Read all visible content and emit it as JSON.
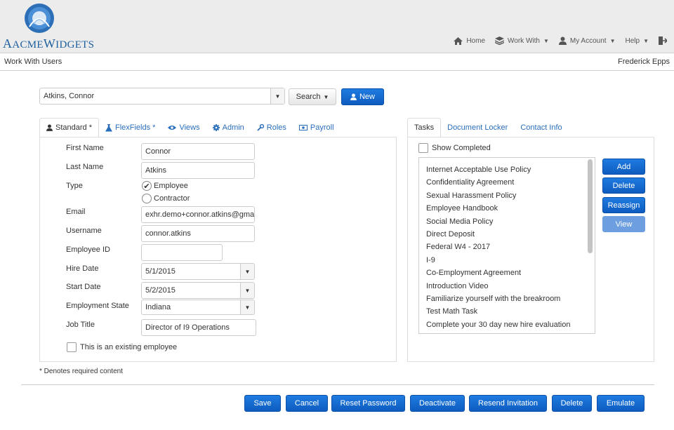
{
  "brand": {
    "name_part1": "Acme",
    "name_part2": "Widgets"
  },
  "topnav": {
    "home": "Home",
    "work_with": "Work With",
    "my_account": "My Account",
    "help": "Help"
  },
  "breadcrumb": "Work With Users",
  "current_user": "Frederick Epps",
  "user_select": {
    "value": "Atkins, Connor"
  },
  "search_button": "Search",
  "new_button": "New",
  "left_tabs": [
    {
      "label": "Standard *",
      "icon": "user-icon"
    },
    {
      "label": "FlexFields *",
      "icon": "flask-icon"
    },
    {
      "label": "Views",
      "icon": "eye-icon"
    },
    {
      "label": "Admin",
      "icon": "gear-icon"
    },
    {
      "label": "Roles",
      "icon": "wrench-icon"
    },
    {
      "label": "Payroll",
      "icon": "money-icon"
    }
  ],
  "form": {
    "first_name": {
      "label": "First Name",
      "value": "Connor"
    },
    "last_name": {
      "label": "Last Name",
      "value": "Atkins"
    },
    "type": {
      "label": "Type",
      "options": [
        "Employee",
        "Contractor"
      ],
      "selected": "Employee"
    },
    "email": {
      "label": "Email",
      "value": "exhr.demo+connor.atkins@gmai"
    },
    "username": {
      "label": "Username",
      "value": "connor.atkins"
    },
    "employee_id": {
      "label": "Employee ID",
      "value": ""
    },
    "hire_date": {
      "label": "Hire Date",
      "value": "5/1/2015"
    },
    "start_date": {
      "label": "Start Date",
      "value": "5/2/2015"
    },
    "employment_state": {
      "label": "Employment State",
      "value": "Indiana"
    },
    "job_title": {
      "label": "Job Title",
      "value": "Director of I9 Operations"
    },
    "existing_employee": {
      "label": "This is an existing employee",
      "checked": false
    }
  },
  "required_note": "* Denotes required content",
  "right_tabs": [
    "Tasks",
    "Document Locker",
    "Contact Info"
  ],
  "show_completed": {
    "label": "Show Completed",
    "checked": false
  },
  "tasks": [
    "Internet Acceptable Use Policy",
    "Confidentiality Agreement",
    "Sexual Harassment Policy",
    "Employee Handbook",
    "Social Media Policy",
    "Direct Deposit",
    "Federal W4 - 2017",
    "I-9",
    "Co-Employment Agreement",
    "Introduction Video",
    "Familiarize yourself with the breakroom",
    "Test Math Task",
    "Complete your 30 day new hire evaluation"
  ],
  "task_buttons": {
    "add": "Add",
    "delete": "Delete",
    "reassign": "Reassign",
    "view": "View"
  },
  "bottom_buttons": {
    "save": "Save",
    "cancel": "Cancel",
    "reset_password": "Reset Password",
    "deactivate": "Deactivate",
    "resend_invitation": "Resend Invitation",
    "delete": "Delete",
    "emulate": "Emulate"
  },
  "colors": {
    "primary": "#1565c0",
    "link": "#2a6ebb",
    "brand": "#1f5f9e"
  }
}
